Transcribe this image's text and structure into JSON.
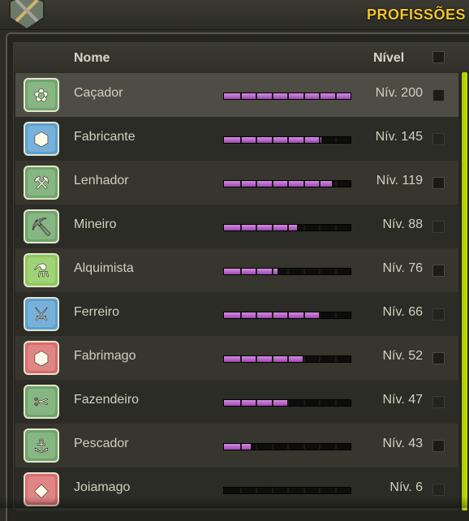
{
  "panel": {
    "title": "PROFISSÕES"
  },
  "header": {
    "name_label": "Nome",
    "level_label": "Nível"
  },
  "colors": {
    "accent": "#f2c62e",
    "bar_fill": "#c27ad2",
    "scroll": "#b5d400"
  },
  "professions": [
    {
      "name": "Caçador",
      "level": "Nív. 200",
      "progress": 1.0,
      "icon": "hunter-icon",
      "icon_color": "#6da66a",
      "glyph": "✿",
      "selected": true
    },
    {
      "name": "Fabricante",
      "level": "Nív. 145",
      "progress": 0.77,
      "icon": "craftsman-icon",
      "icon_color": "#5aa0d2",
      "glyph": "⬢"
    },
    {
      "name": "Lenhador",
      "level": "Nív. 119",
      "progress": 0.85,
      "icon": "lumberjack-icon",
      "icon_color": "#6da66a",
      "glyph": "⚒"
    },
    {
      "name": "Mineiro",
      "level": "Nív. 88",
      "progress": 0.58,
      "icon": "miner-icon",
      "icon_color": "#6da66a",
      "glyph": "⛏"
    },
    {
      "name": "Alquimista",
      "level": "Nív. 76",
      "progress": 0.42,
      "icon": "alchemist-icon",
      "icon_color": "#8cc85a",
      "glyph": "⚗"
    },
    {
      "name": "Ferreiro",
      "level": "Nív. 66",
      "progress": 0.75,
      "icon": "smith-icon",
      "icon_color": "#5aa0d2",
      "glyph": "⚔"
    },
    {
      "name": "Fabrimago",
      "level": "Nív. 52",
      "progress": 0.62,
      "icon": "craftmagus-icon",
      "icon_color": "#d96b6b",
      "glyph": "⬢"
    },
    {
      "name": "Fazendeiro",
      "level": "Nív. 47",
      "progress": 0.51,
      "icon": "farmer-icon",
      "icon_color": "#6da66a",
      "glyph": "✂"
    },
    {
      "name": "Pescador",
      "level": "Nív. 43",
      "progress": 0.21,
      "icon": "fisherman-icon",
      "icon_color": "#6da66a",
      "glyph": "⚓"
    },
    {
      "name": "Joiamago",
      "level": "Nív. 6",
      "progress": 0.0,
      "icon": "jewelmagus-icon",
      "icon_color": "#d96b6b",
      "glyph": "◆"
    }
  ]
}
